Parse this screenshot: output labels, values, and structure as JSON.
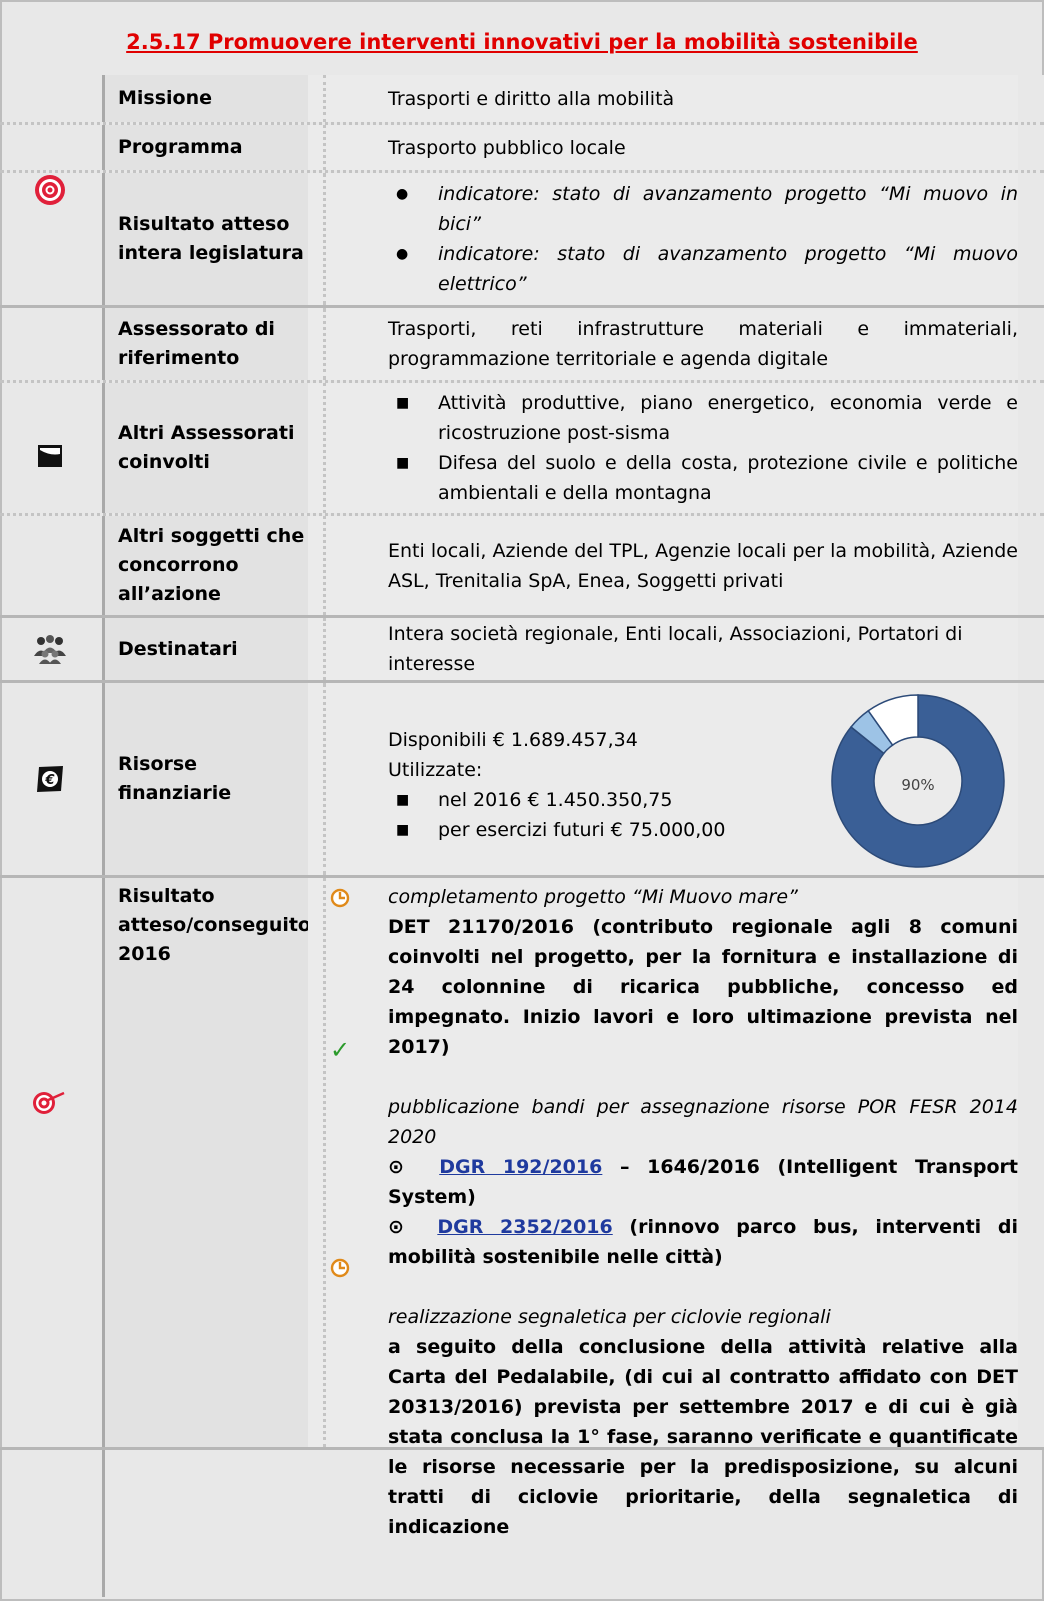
{
  "title": "2.5.17 Promuovere interventi innovativi per la mobilità sostenibile",
  "rows": {
    "missione": {
      "label": "Missione",
      "value": "Trasporti e diritto alla mobilità"
    },
    "programma": {
      "label": "Programma",
      "value": "Trasporto pubblico locale"
    },
    "risultato_legislatura": {
      "label1": "Risultato atteso",
      "label2": "intera legislatura",
      "items": [
        "indicatore: stato di avanzamento progetto “Mi muovo in bici”",
        "indicatore: stato di avanzamento progetto “Mi muovo elettrico”"
      ]
    },
    "assessorato": {
      "label1": "Assessorato di",
      "label2": "riferimento",
      "value": "Trasporti, reti infrastrutture materiali e immateriali, programmazione territoriale e agenda digitale"
    },
    "altri_assessorati": {
      "label1": "Altri Assessorati",
      "label2": "coinvolti",
      "items": [
        "Attività produttive, piano energetico, economia verde e ricostruzione post-sisma",
        "Difesa del suolo e della costa, protezione civile e politiche ambientali e della montagna"
      ]
    },
    "altri_soggetti": {
      "label1": "Altri soggetti che",
      "label2": "concorrono",
      "label3": "all’azione",
      "value": "Enti locali, Aziende del TPL, Agenzie locali per la mobilità, Aziende ASL, Trenitalia SpA, Enea, Soggetti privati"
    },
    "destinatari": {
      "label": "Destinatari",
      "value": "Intera società regionale, Enti locali, Associazioni, Portatori di interesse"
    },
    "risorse": {
      "label1": "Risorse",
      "label2": "finanziarie",
      "disponibili": "Disponibili € 1.689.457,34",
      "utilizzate": "Utilizzate:",
      "items": [
        "nel 2016 € 1.450.350,75",
        "per esercizi futuri € 75.000,00"
      ],
      "donut_label": "90%",
      "donut_slices": [
        0.858,
        0.044,
        0.098
      ],
      "donut_colors": [
        "#3a5f96",
        "#9dc3e6",
        "#ffffff"
      ]
    },
    "risultato_2016": {
      "label1": "Risultato",
      "label2": "atteso/conseguito",
      "label3": "2016",
      "entries": [
        {
          "status": "in-progress",
          "heading": "completamento progetto “Mi Muovo mare”",
          "body": "DET 21170/2016 (contributo regionale agli 8 comuni coinvolti nel progetto, per la fornitura e installazione di 24 colonnine di ricarica pubbliche, concesso ed impegnato. Inizio lavori e loro ultimazione prevista nel 2017)"
        },
        {
          "status": "done",
          "heading": "pubblicazione bandi per assegnazione risorse POR FESR 2014 2020",
          "link1": "DGR 192/2016",
          "rest1": " – 1646/2016 (Intelligent Transport System)",
          "link2": "DGR 2352/2016",
          "rest2": " (rinnovo parco bus, interventi di mobilità sostenibile nelle città)"
        },
        {
          "status": "in-progress",
          "heading": "realizzazione segnaletica per ciclovie regionali",
          "body": "a seguito della conclusione della attività relative alla Carta del Pedalabile, (di cui al contratto affidato con DET 20313/2016) prevista per settembre 2017 e di cui è già stata conclusa la 1° fase, saranno verificate e quantificate le risorse necessarie per la predisposizione, su alcuni tratti di ciclovie prioritarie, della segnaletica di indicazione"
        }
      ]
    }
  }
}
